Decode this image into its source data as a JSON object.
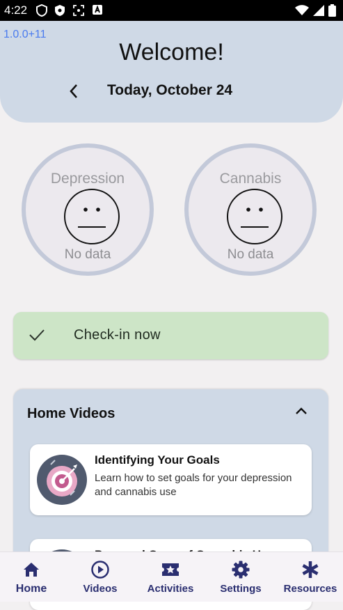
{
  "status_bar": {
    "time": "4:22",
    "icons_left": [
      "shield-outline-icon",
      "shield-filled-icon",
      "scan-icon",
      "a-box-icon"
    ],
    "icons_right": [
      "wifi-icon",
      "signal-icon",
      "battery-icon"
    ]
  },
  "header": {
    "version": "1.0.0+11",
    "title": "Welcome!",
    "date": "Today, October 24"
  },
  "gauges": [
    {
      "title": "Depression",
      "status": "No data"
    },
    {
      "title": "Cannabis",
      "status": "No data"
    }
  ],
  "checkin": {
    "label": "Check-in now"
  },
  "home_videos": {
    "title": "Home Videos",
    "items": [
      {
        "title": "Identifying Your Goals",
        "description": "Learn how to set goals for your depression and cannabis use"
      },
      {
        "title": "Pros and Cons of Cannabis Use",
        "description": ""
      }
    ]
  },
  "bottom_nav": {
    "items": [
      {
        "label": "Home",
        "icon": "home-icon",
        "active": true
      },
      {
        "label": "Videos",
        "icon": "play-circle-icon",
        "active": false
      },
      {
        "label": "Activities",
        "icon": "ticket-star-icon",
        "active": false
      },
      {
        "label": "Settings",
        "icon": "gear-icon",
        "active": false
      },
      {
        "label": "Resources",
        "icon": "asterisk-icon",
        "active": false
      }
    ]
  },
  "colors": {
    "header_bg": "#cfd9e6",
    "checkin_bg": "#cde5c7",
    "nav_text": "#2a2e70",
    "version": "#4a7bef"
  }
}
